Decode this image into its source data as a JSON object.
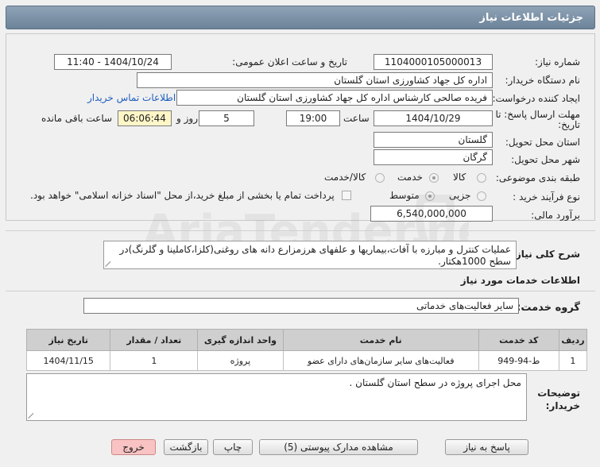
{
  "header": {
    "title": "جزئیات اطلاعات نیاز"
  },
  "form": {
    "need_number_label": "شماره نیاز:",
    "need_number": "1104000105000013",
    "announce_label": "تاریخ و ساعت اعلان عمومی:",
    "announce_value": "1404/10/24 - 11:40",
    "buyer_org_label": "نام دستگاه خریدار:",
    "buyer_org": "اداره کل جهاد کشاورزی استان گلستان",
    "requester_label": "ایجاد کننده درخواست:",
    "requester": "فریده صالحی کارشناس اداره کل جهاد کشاورزی استان گلستان",
    "contact_link": "اطلاعات تماس خریدار",
    "deadline_label_1": "مهلت ارسال پاسخ: تا",
    "deadline_label_2": "تاریخ:",
    "deadline_date": "1404/10/29",
    "time_label": "ساعت",
    "deadline_time": "19:00",
    "days_value": "5",
    "days_label": "روز و",
    "remaining_time": "06:06:44",
    "remaining_label": "ساعت باقی مانده",
    "province_label": "استان محل تحویل:",
    "province": "گلستان",
    "city_label": "شهر محل تحویل:",
    "city": "گرگان",
    "category_label": "طبقه بندی موضوعی:",
    "category_options": [
      "کالا",
      "خدمت",
      "کالا/خدمت"
    ],
    "category_selected": "خدمت",
    "process_label": "نوع فرآیند خرید :",
    "process_options": [
      "جزیی",
      "متوسط"
    ],
    "process_selected": "متوسط",
    "payment_note": "پرداخت تمام یا بخشی از مبلغ خرید،از محل \"اسناد خزانه اسلامی\" خواهد بود.",
    "budget_label": "برآورد مالی:",
    "budget": "6,540,000,000"
  },
  "summary": {
    "label": "شرح کلی نیاز:",
    "text": "عملیات کنترل و مبارزه با آفات،بیماریها و علفهای هرزمزارع دانه های روغنی(کلزا،کاملینا و گلرنگ)در سطح 1000هکتار."
  },
  "services": {
    "section_title": "اطلاعات خدمات مورد نیاز",
    "group_label": "گروه خدمت:",
    "group_value": "سایر فعالیت‌های خدماتی",
    "table": {
      "headers": [
        "ردیف",
        "کد خدمت",
        "نام خدمت",
        "واحد اندازه گیری",
        "تعداد / مقدار",
        "تاریخ نیاز"
      ],
      "rows": [
        [
          "1",
          "ط-94-949",
          "فعالیت‌های سایر سازمان‌های دارای عضو",
          "پروژه",
          "1",
          "1404/11/15"
        ]
      ]
    }
  },
  "buyer_notes": {
    "label": "توضیحات خریدار:",
    "text": "محل اجرای پروژه در سطح استان گلستان ."
  },
  "buttons": {
    "reply": "پاسخ به نیاز",
    "attachments": "مشاهده مدارک پیوستی (5)",
    "print": "چاپ",
    "back": "بازگشت",
    "exit": "خروج"
  },
  "watermark": {
    "text": "AriaTender.net"
  }
}
